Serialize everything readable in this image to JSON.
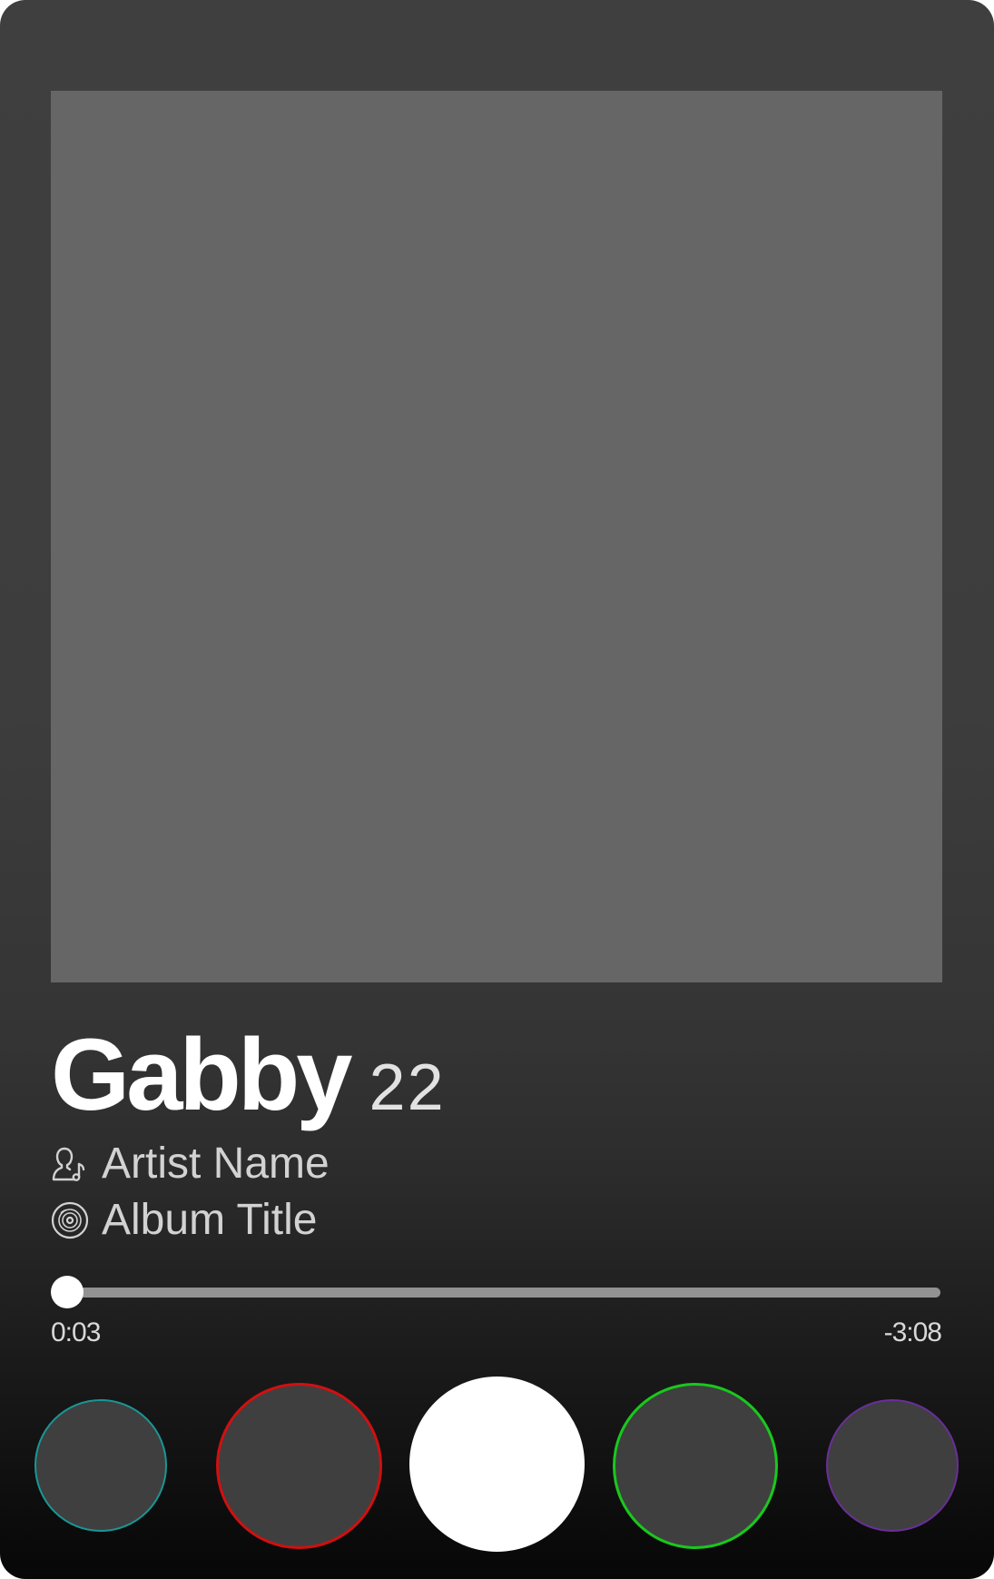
{
  "track": {
    "title": "Gabby",
    "age": "22",
    "artist": "Artist Name",
    "album": "Album Title"
  },
  "icons": {
    "artist": "artist-person-music-note-icon",
    "album": "vinyl-disc-icon"
  },
  "progress": {
    "elapsed": "0:03",
    "remaining": "-3:08",
    "fraction": 0.016
  },
  "controls": [
    {
      "name": "control-circle-1",
      "border": "#1a9696"
    },
    {
      "name": "control-circle-2",
      "border": "#d01010"
    },
    {
      "name": "control-circle-3",
      "fill": "#ffffff"
    },
    {
      "name": "control-circle-4",
      "border": "#19c81c"
    },
    {
      "name": "control-circle-5",
      "border": "#6a2e9a"
    }
  ],
  "colors": {
    "artwork_placeholder": "#666666",
    "track_bar": "#929292",
    "text_primary": "#ffffff",
    "text_secondary": "#d2d2d2"
  }
}
